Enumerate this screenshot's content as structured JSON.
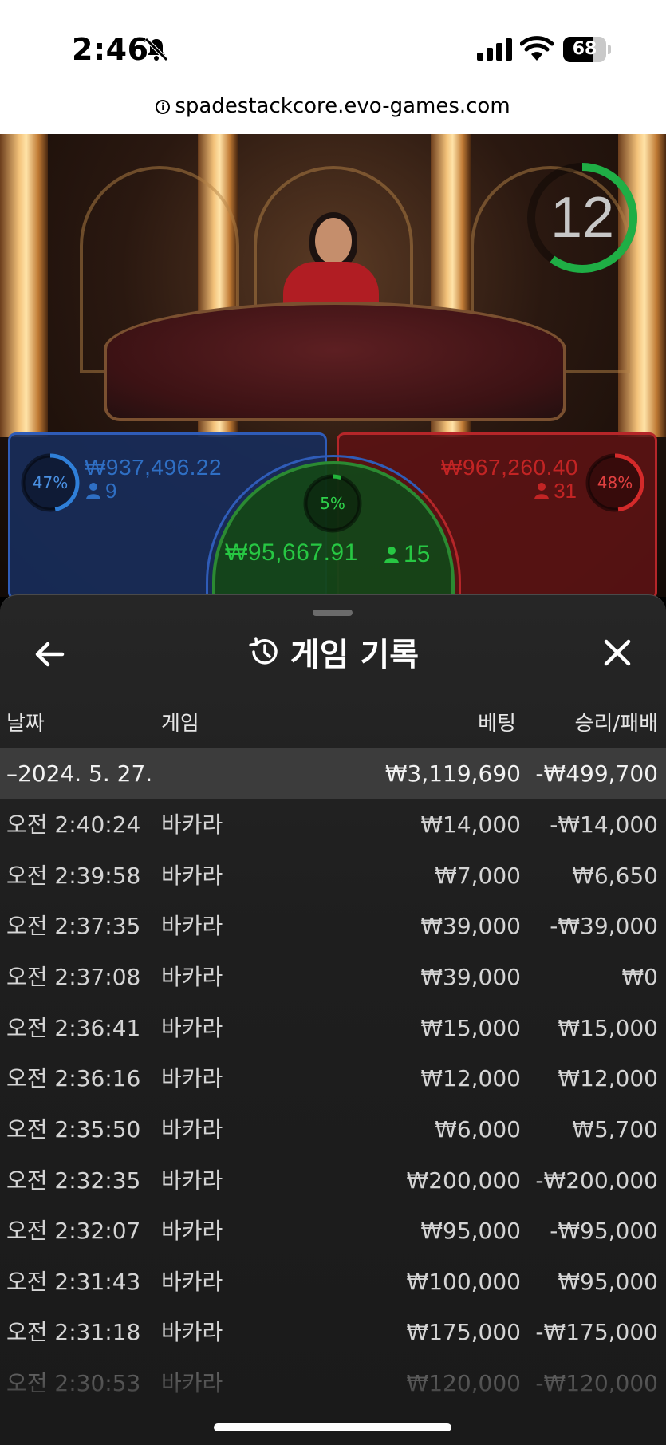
{
  "status_bar": {
    "time": "2:46",
    "battery": "68",
    "battery_level": 0.68,
    "icons": [
      "bell-slash-icon",
      "cellular-signal-icon",
      "wifi-icon",
      "battery-icon"
    ]
  },
  "browser": {
    "url": "spadestackcore.evo-games.com",
    "url_icon": "info-icon"
  },
  "game": {
    "timer": "12",
    "timer_progress": 0.6,
    "player": {
      "percent": "47%",
      "percent_value": 0.47,
      "amount": "₩937,496.22",
      "count": "9",
      "color": "#2f7fd8"
    },
    "banker": {
      "percent": "48%",
      "percent_value": 0.48,
      "amount": "₩967,260.40",
      "count": "31",
      "color": "#d42a2a"
    },
    "tie": {
      "percent": "5%",
      "percent_value": 0.05,
      "amount": "₩95,667.91",
      "count": "15",
      "color": "#22b43a"
    }
  },
  "history": {
    "title": "게임 기록",
    "back_icon": "arrow-left-icon",
    "history_icon": "history-icon",
    "close_icon": "close-icon",
    "columns": {
      "date": "날짜",
      "game": "게임",
      "bet": "베팅",
      "result": "승리/패배"
    },
    "date_group": {
      "date": "–2024. 5. 27.",
      "bet_total": "₩3,119,690",
      "result_total": "-₩499,700"
    },
    "rows": [
      {
        "time": "오전 2:40:24",
        "game": "바카라",
        "bet": "₩14,000",
        "result": "-₩14,000"
      },
      {
        "time": "오전 2:39:58",
        "game": "바카라",
        "bet": "₩7,000",
        "result": "₩6,650"
      },
      {
        "time": "오전 2:37:35",
        "game": "바카라",
        "bet": "₩39,000",
        "result": "-₩39,000"
      },
      {
        "time": "오전 2:37:08",
        "game": "바카라",
        "bet": "₩39,000",
        "result": "₩0"
      },
      {
        "time": "오전 2:36:41",
        "game": "바카라",
        "bet": "₩15,000",
        "result": "₩15,000"
      },
      {
        "time": "오전 2:36:16",
        "game": "바카라",
        "bet": "₩12,000",
        "result": "₩12,000"
      },
      {
        "time": "오전 2:35:50",
        "game": "바카라",
        "bet": "₩6,000",
        "result": "₩5,700"
      },
      {
        "time": "오전 2:32:35",
        "game": "바카라",
        "bet": "₩200,000",
        "result": "-₩200,000"
      },
      {
        "time": "오전 2:32:07",
        "game": "바카라",
        "bet": "₩95,000",
        "result": "-₩95,000"
      },
      {
        "time": "오전 2:31:43",
        "game": "바카라",
        "bet": "₩100,000",
        "result": "₩95,000"
      },
      {
        "time": "오전 2:31:18",
        "game": "바카라",
        "bet": "₩175,000",
        "result": "-₩175,000"
      },
      {
        "time": "오전 2:30:53",
        "game": "바카라",
        "bet": "₩120,000",
        "result": "-₩120,000"
      }
    ]
  }
}
